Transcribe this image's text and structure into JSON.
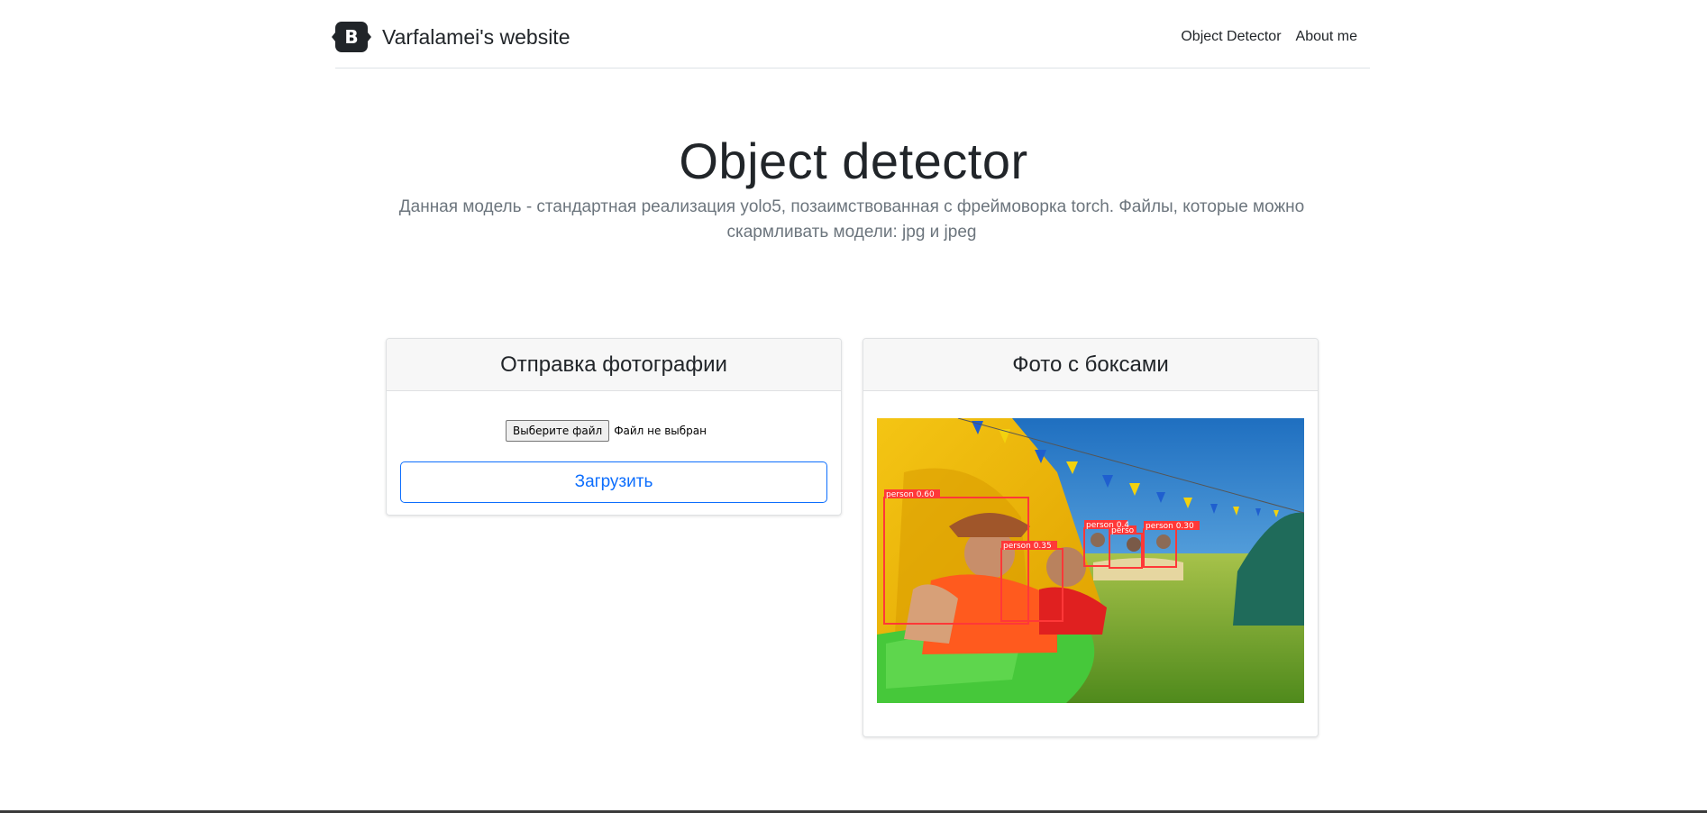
{
  "header": {
    "brand_logo": "B",
    "brand_name": "Varfalamei's website",
    "nav": [
      "Object Detector",
      "About me"
    ]
  },
  "hero": {
    "title": "Object detector",
    "subtitle": "Данная модель - стандартная реализация yolo5, позаимствованная с фреймоворка torch. Файлы, которые можно скармливать модели: jpg и jpeg"
  },
  "upload_card": {
    "title": "Отправка фотографии",
    "file_button": "Выберите файл",
    "file_status": "Файл не выбран",
    "submit_label": "Загрузить"
  },
  "result_card": {
    "title": "Фото с боксами",
    "detections": [
      {
        "label": "person 0.60"
      },
      {
        "label": "person 0.35"
      },
      {
        "label": "person 0.4"
      },
      {
        "label": "perso"
      },
      {
        "label": "person 0.30"
      }
    ]
  },
  "colors": {
    "accent": "#0d6efd",
    "box": "#ff3838",
    "muted_text": "#6c757d"
  }
}
